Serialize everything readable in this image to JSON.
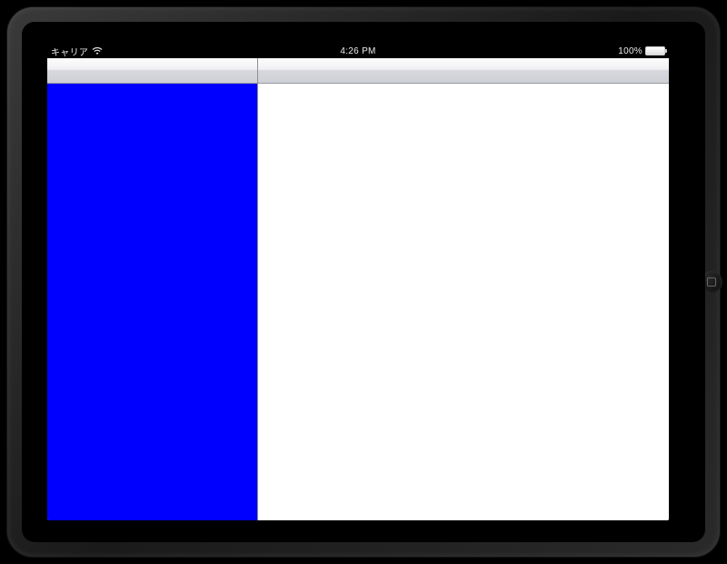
{
  "statusBar": {
    "carrier": "キャリア",
    "time": "4:26 PM",
    "batteryPercent": "100%"
  },
  "splitView": {
    "master": {
      "navTitle": "",
      "backgroundColor": "#0000ff"
    },
    "detail": {
      "navTitle": "",
      "backgroundColor": "#ffffff"
    }
  }
}
